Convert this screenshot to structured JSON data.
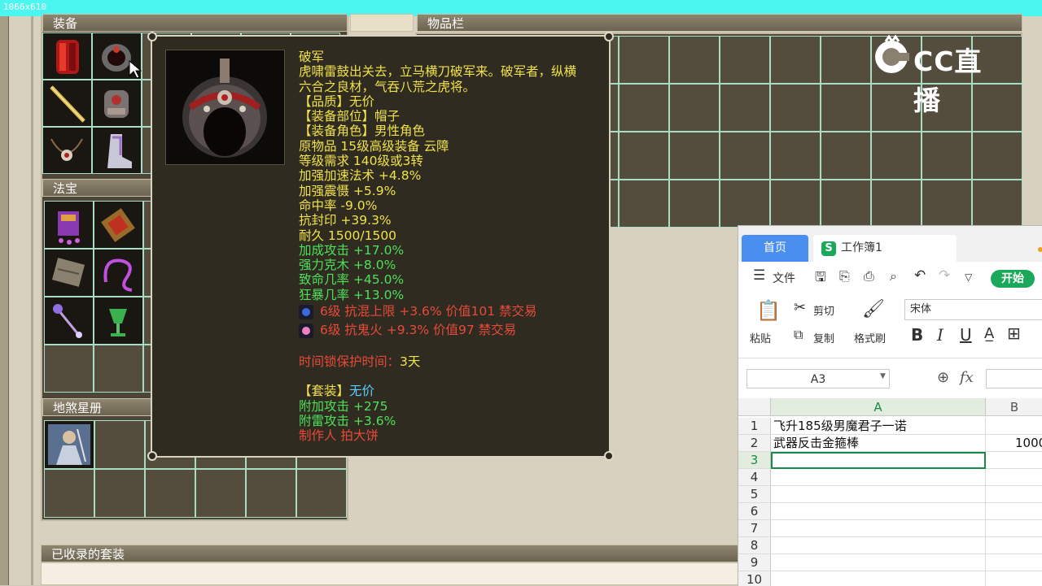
{
  "overlay_label": "1066x610",
  "panels": {
    "equipment_title": "装备",
    "inventory_title": "物品栏",
    "magic_treasure_title": "法宝",
    "star_book_title": "地煞星册",
    "collected_sets_title": "已收录的套装"
  },
  "tooltip": {
    "name": "破军",
    "desc1": "虎啸雷鼓出关去，立马横刀破军来。破军者，纵横",
    "desc2": "六合之良材，气吞八荒之虎将。",
    "quality": "【品质】无价",
    "slot": "【装备部位】帽子",
    "role": "【装备角色】男性角色",
    "origin": "原物品 15级高级装备 云障",
    "level_req": "等级需求 140级或3转",
    "stat1": "加强加速法术 +4.8%",
    "stat2": "加强震慑 +5.9%",
    "stat3": "命中率 -9.0%",
    "stat4": "抗封印 +39.3%",
    "durability": "耐久 1500/1500",
    "bonus1": "加成攻击 +17.0%",
    "bonus2": "强力克木 +8.0%",
    "bonus3": "致命几率 +45.0%",
    "bonus4": "狂暴几率 +13.0%",
    "gem1": "6级 抗混上限 +3.6% 价值101 禁交易",
    "gem2": "6级 抗鬼火 +9.3% 价值97 禁交易",
    "lock_label": "时间锁保护时间：",
    "lock_value": "3天",
    "set_label": "【套装】",
    "set_value": "无价",
    "set_bonus1": "附加攻击 +275",
    "set_bonus2": "附雷攻击 +3.6%",
    "maker": "制作人 拍大饼"
  },
  "logo": {
    "text": "CC直播"
  },
  "spreadsheet": {
    "tab_home": "首页",
    "tab_book": "工作簿1",
    "menu_file": "文件",
    "start_button": "开始",
    "paste": "粘贴",
    "cut": "剪切",
    "copy": "复制",
    "format_painter": "格式刷",
    "font_name": "宋体",
    "bold": "B",
    "italic": "I",
    "underline": "U",
    "name_box": "A3",
    "fx": "fx",
    "col_a": "A",
    "col_b": "B",
    "rows": [
      "1",
      "2",
      "3",
      "4",
      "5",
      "6",
      "7",
      "8",
      "9",
      "10"
    ],
    "a1": "飞升185级男魔君子一诺",
    "a2": "武器反击金箍棒",
    "b2": "1000"
  }
}
